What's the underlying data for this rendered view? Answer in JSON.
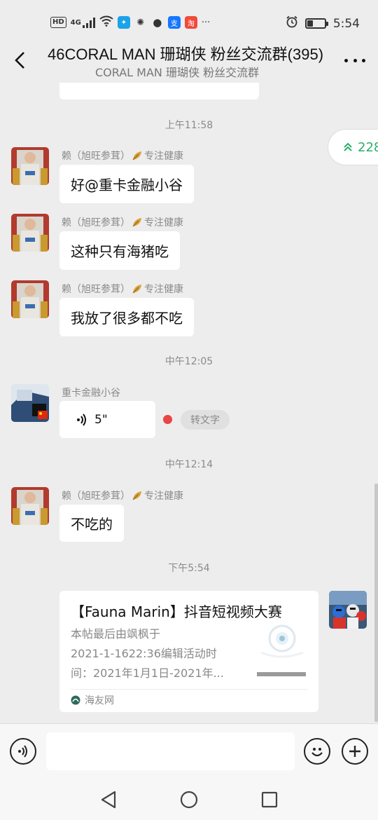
{
  "status_bar": {
    "hd": "HD",
    "network": "4G",
    "time": "5:54",
    "battery_level": 0.35,
    "app_icons": [
      "lightbulb-icon",
      "weibo-icon",
      "qq-icon",
      "alipay-icon",
      "taobao-icon"
    ],
    "more": "···"
  },
  "header": {
    "title": "46CORAL MAN 珊瑚侠 粉丝交流群(395)",
    "subtitle": "CORAL MAN 珊瑚侠 粉丝交流群"
  },
  "float_badge": {
    "count": "228"
  },
  "messages": [
    {
      "type": "time",
      "text": "上午11:58"
    },
    {
      "type": "text",
      "sender_name": "赖（旭旺参茸）",
      "sender_suffix": "专注健康",
      "text": "好@重卡金融小谷"
    },
    {
      "type": "text",
      "sender_name": "赖（旭旺参茸）",
      "sender_suffix": "专注健康",
      "text": "这种只有海猪吃"
    },
    {
      "type": "text",
      "sender_name": "赖（旭旺参茸）",
      "sender_suffix": "专注健康",
      "text": "我放了很多都不吃"
    },
    {
      "type": "time",
      "text": "中午12:05"
    },
    {
      "type": "voice",
      "sender_name": "重卡金融小谷",
      "duration": "5\"",
      "convert_label": "转文字"
    },
    {
      "type": "time",
      "text": "中午12:14"
    },
    {
      "type": "text",
      "sender_name": "赖（旭旺参茸）",
      "sender_suffix": "专注健康",
      "text": "不吃的"
    },
    {
      "type": "time",
      "text": "下午5:54"
    },
    {
      "type": "link_card",
      "title": "【Fauna Marin】抖音短视频大赛",
      "desc_lines": [
        "本帖最后由飒枫于",
        "2021-1-1622:36编辑活动时",
        "间：2021年1月1日-2021年..."
      ],
      "source": "海友网"
    }
  ],
  "colors": {
    "background": "#ededed",
    "bubble": "#ffffff",
    "accent_green": "#2aae67",
    "unread_dot": "#e84545"
  }
}
